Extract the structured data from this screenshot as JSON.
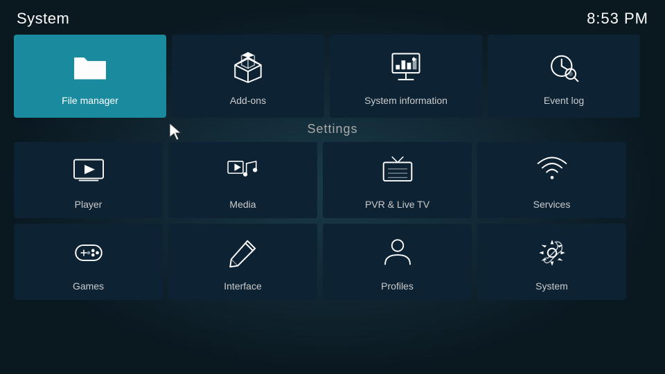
{
  "header": {
    "title": "System",
    "time": "8:53 PM"
  },
  "top_tiles": [
    {
      "id": "file-manager",
      "label": "File manager",
      "active": true
    },
    {
      "id": "add-ons",
      "label": "Add-ons",
      "active": false
    },
    {
      "id": "system-information",
      "label": "System information",
      "active": false
    },
    {
      "id": "event-log",
      "label": "Event log",
      "active": false
    }
  ],
  "settings_label": "Settings",
  "settings_rows": [
    [
      {
        "id": "player",
        "label": "Player"
      },
      {
        "id": "media",
        "label": "Media"
      },
      {
        "id": "pvr-live-tv",
        "label": "PVR & Live TV"
      },
      {
        "id": "services",
        "label": "Services"
      }
    ],
    [
      {
        "id": "games",
        "label": "Games"
      },
      {
        "id": "interface",
        "label": "Interface"
      },
      {
        "id": "profiles",
        "label": "Profiles"
      },
      {
        "id": "system",
        "label": "System"
      }
    ]
  ]
}
